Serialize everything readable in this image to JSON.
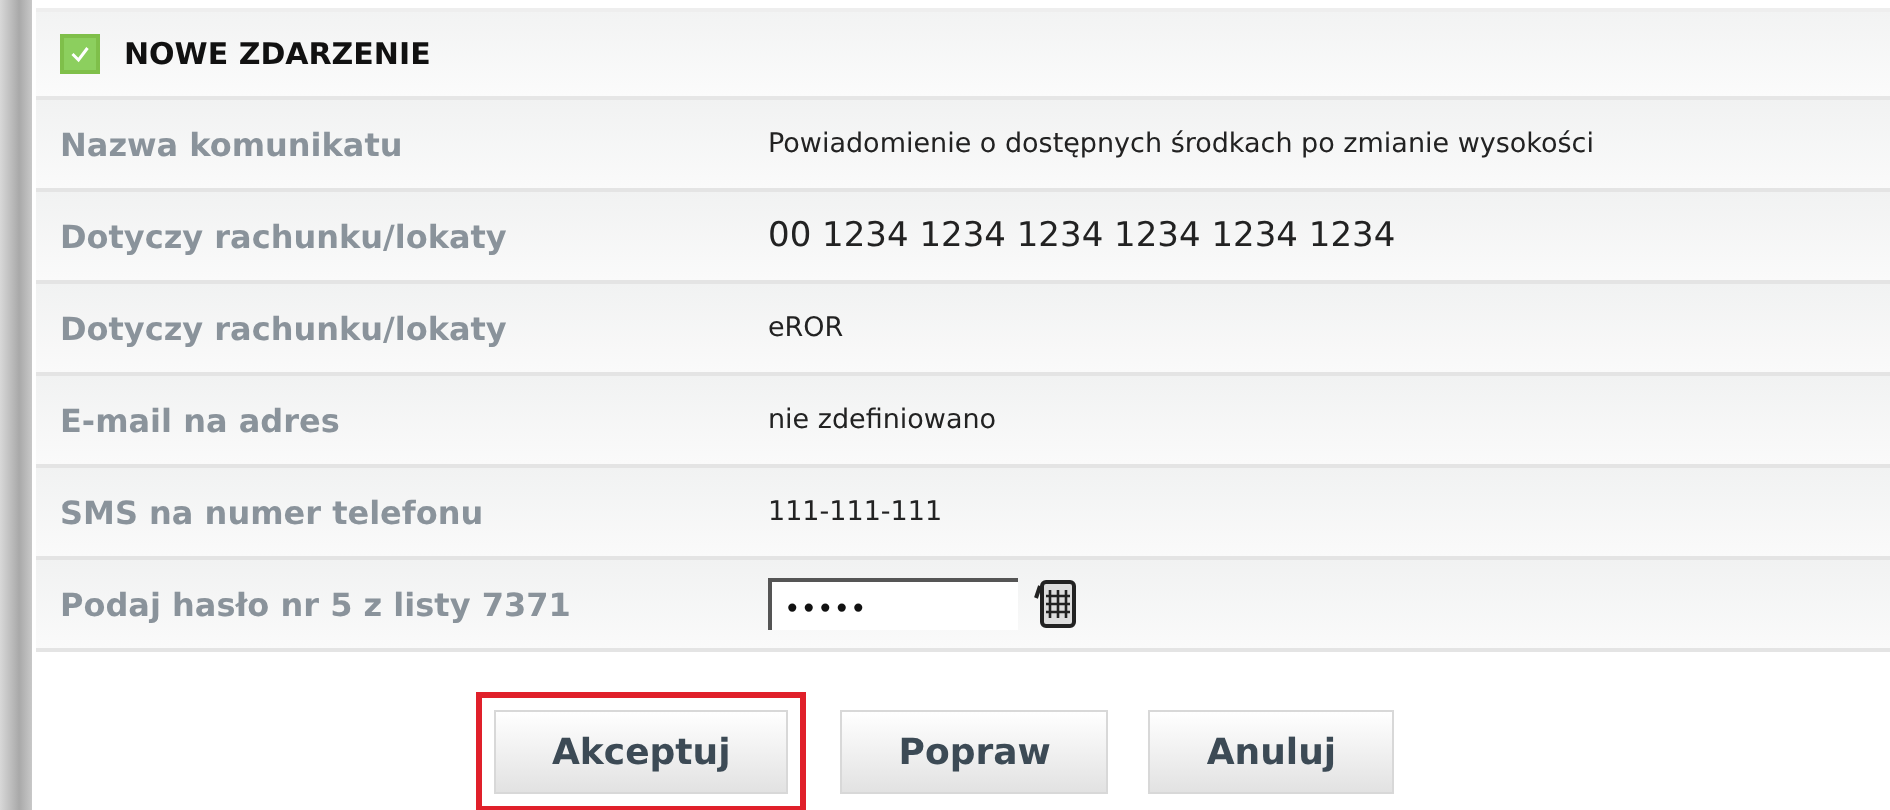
{
  "panel": {
    "title": "NOWE ZDARZENIE",
    "checked": true
  },
  "rows": [
    {
      "kind": "text",
      "label": "Nazwa komunikatu",
      "value": "Powiadomienie o dostępnych środkach po zmianie wysokości"
    },
    {
      "kind": "text",
      "label": "Dotyczy rachunku/lokaty",
      "value": "00 1234 1234 1234 1234 1234 1234",
      "large": true
    },
    {
      "kind": "text",
      "label": "Dotyczy rachunku/lokaty",
      "value": "eROR"
    },
    {
      "kind": "text",
      "label": "E-mail na adres",
      "value": "nie zdefiniowano"
    },
    {
      "kind": "text",
      "label": "SMS na numer telefonu",
      "value": "111-111-111"
    },
    {
      "kind": "password",
      "label": "Podaj hasło nr 5 z listy 7371",
      "value": "•••••"
    }
  ],
  "buttons": [
    {
      "label": "Akceptuj",
      "highlighted": true
    },
    {
      "label": "Popraw",
      "highlighted": false
    },
    {
      "label": "Anuluj",
      "highlighted": false
    }
  ]
}
